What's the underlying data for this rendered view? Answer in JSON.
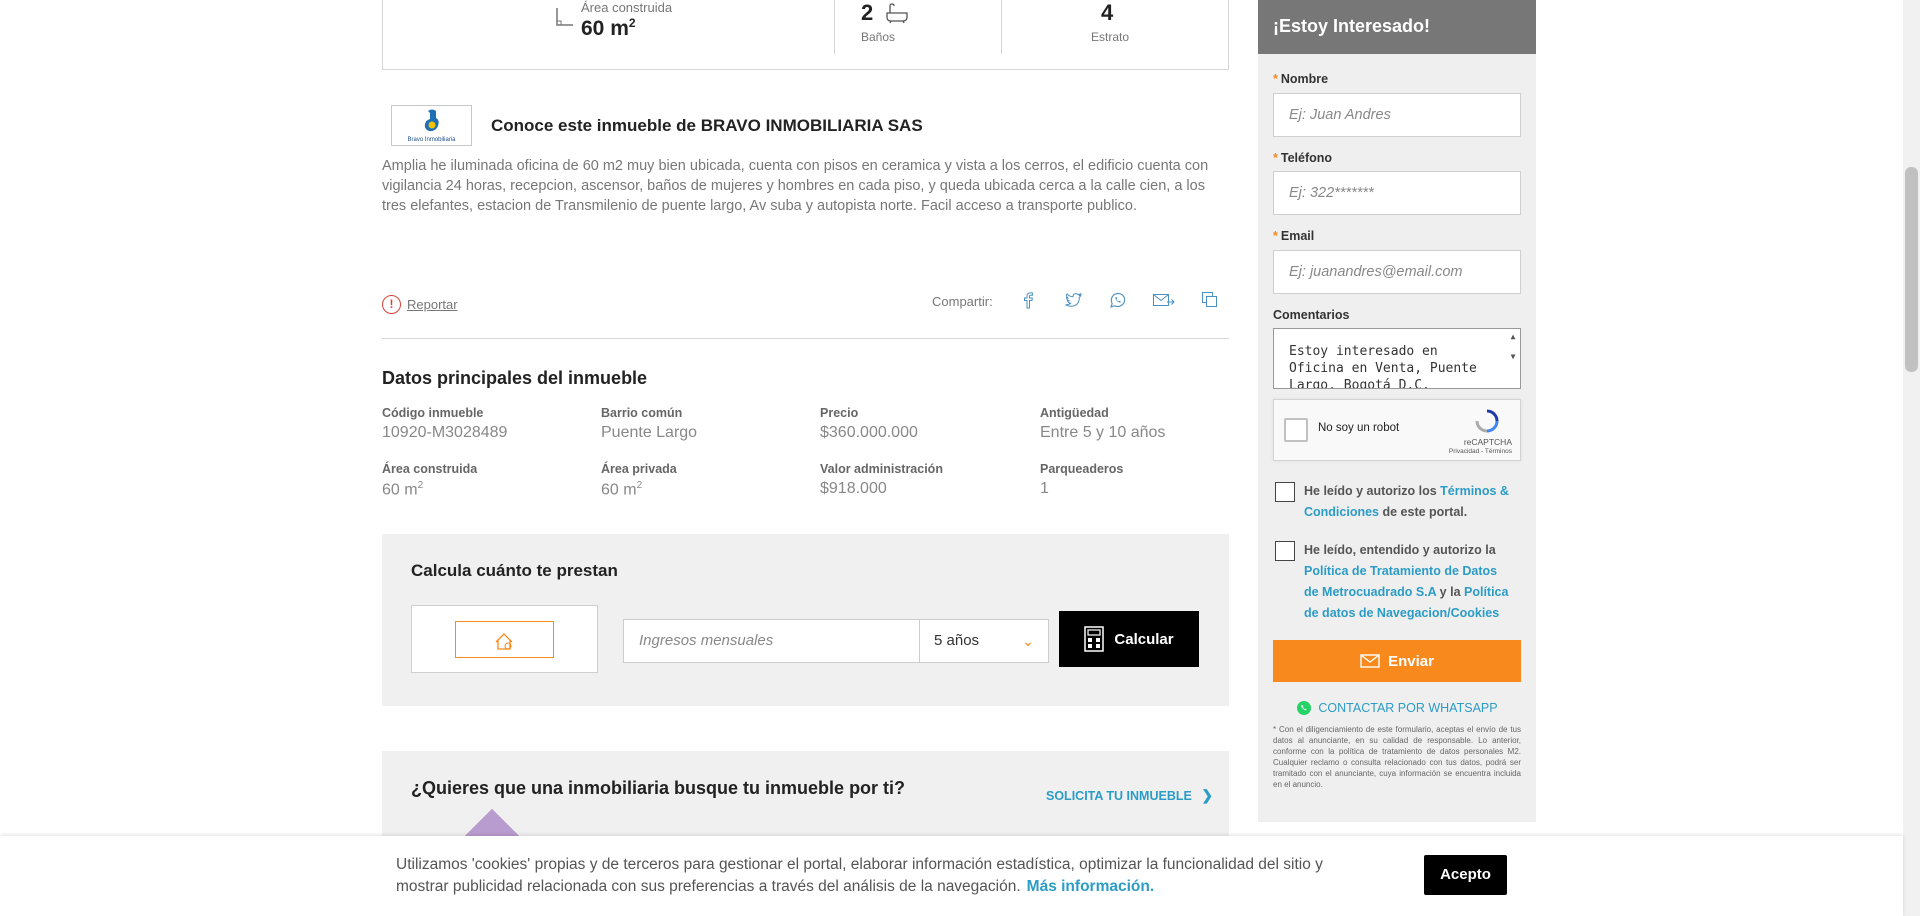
{
  "features": {
    "area_label": "Área construida",
    "area_value": "60 m",
    "area_sup": "2",
    "banos_value": "2",
    "banos_label": "Baños",
    "estrato_value": "4",
    "estrato_label": "Estrato"
  },
  "agency": {
    "logo_text": "Bravo Inmobiliaria",
    "title": "Conoce este inmueble de BRAVO INMOBILIARIA SAS"
  },
  "description": "Amplia he iluminada oficina de 60 m2 muy bien ubicada, cuenta con pisos en ceramica y vista a los cerros, el edificio cuenta con vigilancia 24 horas, recepcion, ascensor, baños de mujeres y hombres en cada piso, y queda ubicada cerca a la calle cien, a los tres elefantes, estacion de Transmilenio de puente largo, Av suba y autopista norte. Facil acceso a transporte publico.",
  "actions": {
    "report_label": "Reportar",
    "share_label": "Compartir:"
  },
  "datos": {
    "title": "Datos principales del inmueble",
    "codigo_label": "Código inmueble",
    "codigo_value": "10920-M3028489",
    "barrio_label": "Barrio común",
    "barrio_value": "Puente Largo",
    "precio_label": "Precio",
    "precio_value": "$360.000.000",
    "antiguedad_label": "Antigüedad",
    "antiguedad_value": "Entre 5 y 10 años",
    "area_construida_label": "Área construida",
    "area_construida_value": "60 m",
    "area_privada_label": "Área privada",
    "area_privada_value": "60 m",
    "m2_sup": "2",
    "admin_label": "Valor administración",
    "admin_value": "$918.000",
    "parqueaderos_label": "Parqueaderos",
    "parqueaderos_value": "1"
  },
  "calculator": {
    "title": "Calcula cuánto te prestan",
    "income_placeholder": "Ingresos mensuales",
    "term_selected": "5 años",
    "button_label": "Calcular"
  },
  "busca": {
    "title": "¿Quieres que una inmobiliaria busque tu inmueble por ti?",
    "link_label": "SOLICITA TU INMUEBLE"
  },
  "form": {
    "header": "¡Estoy Interesado!",
    "required_mark": "*",
    "nombre_label": "Nombre",
    "nombre_placeholder": "Ej: Juan Andres",
    "telefono_label": "Teléfono",
    "telefono_placeholder": "Ej: 322*******",
    "email_label": "Email",
    "email_placeholder": "Ej: juanandres@email.com",
    "comentarios_label": "Comentarios",
    "comentarios_value": "Estoy interesado en Oficina en Venta, Puente Largo, Bogotá D.C.",
    "recaptcha_label": "No soy un robot",
    "recaptcha_brand": "reCAPTCHA",
    "recaptcha_terms": "Privacidad - Términos",
    "terms_prefix": "He leído y autorizo los ",
    "terms_link": "Términos & Condiciones",
    "terms_suffix": " de este portal.",
    "policy_prefix": "He leído, entendido y autorizo la ",
    "policy_link1": "Política de Tratamiento de Datos de Metrocuadrado S.A",
    "policy_mid": " y la ",
    "policy_link2": "Política de datos de Navegacion/Cookies",
    "submit_label": "Enviar",
    "whatsapp_label": "CONTACTAR POR WHATSAPP",
    "legal_text": "* Con el diligenciamiento de este formulario, aceptas el envío de tus datos al anunciante, en su calidad de responsable. Lo anterior, conforme con la política de tratamiento de datos personales M2. Cualquier reclamo o consulta relacionado con tus datos, podrá ser tramitado con el anunciante, cuya información se encuentra incluida en el anuncio."
  },
  "cookies": {
    "text": "Utilizamos 'cookies' propias y de terceros para gestionar el portal, elaborar información estadística, optimizar la funcionalidad del sitio y mostrar publicidad relacionada con sus preferencias a través del análisis de la navegación.",
    "more_link": "Más información.",
    "accept_label": "Acepto"
  },
  "colors": {
    "accent_orange": "#f7891d",
    "link_blue": "#2b9cc6",
    "header_gray": "#777777",
    "panel_gray": "#efefef"
  },
  "icons": [
    "area-icon",
    "bathtub-icon",
    "alert-icon",
    "facebook-icon",
    "twitter-icon",
    "whatsapp-icon",
    "email-share-icon",
    "copy-link-icon",
    "calculator-icon",
    "chevron-down-icon",
    "chevron-right-icon",
    "envelope-icon",
    "recaptcha-icon"
  ]
}
